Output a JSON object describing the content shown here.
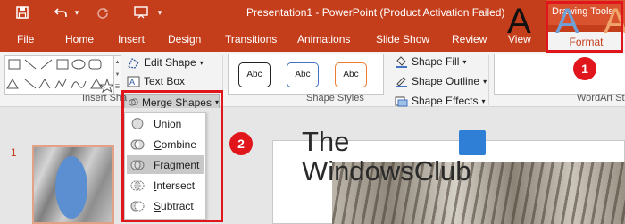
{
  "window": {
    "title": "Presentation1 - PowerPoint (Product Activation Failed)",
    "context_tab_group": "Drawing Tools"
  },
  "quick_access": {
    "save_icon": "save-icon",
    "undo_icon": "undo-icon",
    "redo_icon": "redo-icon",
    "present_icon": "start-from-beginning-icon"
  },
  "tabs": [
    "File",
    "Home",
    "Insert",
    "Design",
    "Transitions",
    "Animations",
    "Slide Show",
    "Review",
    "View"
  ],
  "active_tab": "Format",
  "ribbon": {
    "insert_shapes": {
      "edit_shape_label": "Edit Shape",
      "text_box_label": "Text Box",
      "merge_shapes_label": "Merge Shapes",
      "group_label": "Insert Sha"
    },
    "shape_styles": {
      "samples": [
        "Abc",
        "Abc",
        "Abc"
      ],
      "shape_fill_label": "Shape Fill",
      "shape_outline_label": "Shape Outline",
      "shape_effects_label": "Shape Effects",
      "group_label": "Shape Styles"
    },
    "wordart": {
      "samples": [
        "A",
        "A",
        "A"
      ],
      "group_label": "WordArt St"
    }
  },
  "merge_menu": {
    "items": [
      {
        "label": "Union",
        "underline": "U",
        "icon": "union-icon"
      },
      {
        "label": "Combine",
        "underline": "C",
        "icon": "combine-icon"
      },
      {
        "label": "Fragment",
        "underline": "F",
        "icon": "fragment-icon",
        "hover": true
      },
      {
        "label": "Intersect",
        "underline": "I",
        "icon": "intersect-icon"
      },
      {
        "label": "Subtract",
        "underline": "S",
        "icon": "subtract-icon"
      }
    ]
  },
  "annotations": {
    "step1": "1",
    "step2": "2"
  },
  "thumbnail": {
    "number": "1"
  },
  "watermark": {
    "line1": "The",
    "line2": "WindowsClub"
  },
  "colors": {
    "accent": "#c43e1c",
    "highlight": "#e0161c",
    "shape_fill": "#5b8fd2"
  }
}
